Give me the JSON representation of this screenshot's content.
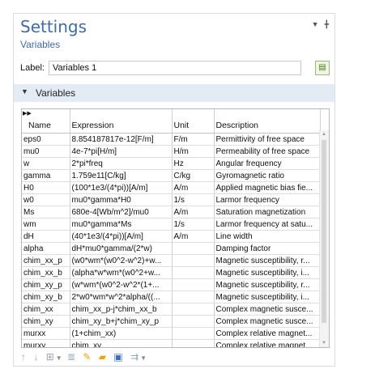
{
  "panel": {
    "title": "Settings",
    "subtitle": "Variables"
  },
  "label_field": {
    "label": "Label:",
    "value": "Variables 1"
  },
  "section": {
    "title": "Variables"
  },
  "table": {
    "headers": [
      "Name",
      "Expression",
      "Unit",
      "Description"
    ],
    "rows": [
      [
        "eps0",
        "8.854187817e-12[F/m]",
        "F/m",
        "Permittivity of free space"
      ],
      [
        "mu0",
        "4e-7*pi[H/m]",
        "H/m",
        "Permeability of free space"
      ],
      [
        "w",
        "2*pi*freq",
        "Hz",
        "Angular frequency"
      ],
      [
        "gamma",
        "1.759e11[C/kg]",
        "C/kg",
        "Gyromagnetic ratio"
      ],
      [
        "H0",
        "(100*1e3/(4*pi))[A/m]",
        "A/m",
        "Applied magnetic bias fie..."
      ],
      [
        "w0",
        "mu0*gamma*H0",
        "1/s",
        "Larmor frequency"
      ],
      [
        "Ms",
        "680e-4[Wb/m^2]/mu0",
        "A/m",
        "Saturation magnetization"
      ],
      [
        "wm",
        "mu0*gamma*Ms",
        "1/s",
        "Larmor frequency at satu..."
      ],
      [
        "dH",
        "(40*1e3/(4*pi))[A/m]",
        "A/m",
        "Line width"
      ],
      [
        "alpha",
        "dH*mu0*gamma/(2*w)",
        "",
        "Damping factor"
      ],
      [
        "chim_xx_p",
        "(w0*wm*(w0^2-w^2)+w...",
        "",
        "Magnetic susceptibility, r..."
      ],
      [
        "chim_xx_b",
        "(alpha*w*wm*(w0^2+w...",
        "",
        "Magnetic susceptibility, i..."
      ],
      [
        "chim_xy_p",
        "(w*wm*(w0^2-w^2*(1+...",
        "",
        "Magnetic susceptibility, r..."
      ],
      [
        "chim_xy_b",
        "2*w0*wm*w^2*alpha/((...",
        "",
        "Magnetic susceptibility, i..."
      ],
      [
        "chim_xx",
        "chim_xx_p-j*chim_xx_b",
        "",
        "Complex magnetic susce..."
      ],
      [
        "chim_xy",
        "chim_xy_b+j*chim_xy_p",
        "",
        "Complex magnetic susce..."
      ],
      [
        "murxx",
        "(1+chim_xx)",
        "",
        "Complex relative magnet..."
      ],
      [
        "murxy",
        "chim_xy",
        "",
        "Complex relative magnet..."
      ]
    ]
  },
  "icons": {
    "header_menu": "triangle-down",
    "header_pin": "pin",
    "label_button": "identity-icon",
    "section_toggle": "triangle-down",
    "corner": "double-right-arrow",
    "toolbar": [
      "move-up",
      "move-down",
      "insert",
      "clear",
      "edit",
      "open-file",
      "save",
      "export"
    ]
  },
  "colors": {
    "title": "#3f6ba8",
    "section_bg": "#e3ebf5",
    "label_button_bg": "#eef5e3"
  }
}
